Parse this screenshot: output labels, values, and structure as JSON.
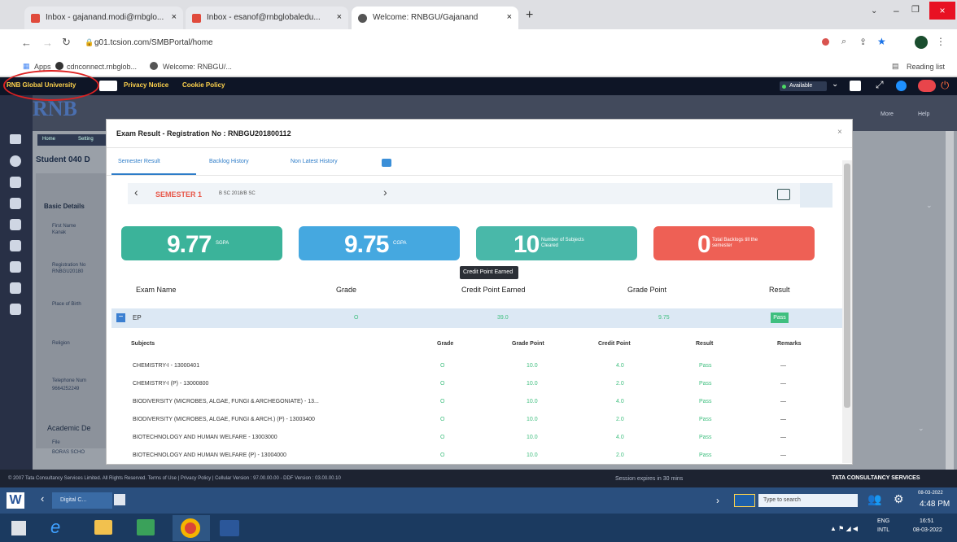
{
  "browser": {
    "tabs": [
      {
        "title": "Inbox - gajanand.modi@rnbglo..."
      },
      {
        "title": "Inbox - esanof@rnbglobaledu..."
      },
      {
        "title": "Welcome: RNBGU/Gajanand"
      }
    ],
    "url": "g01.tcsion.com/SMBPortal/home",
    "bookmarks": {
      "apps": "Apps",
      "b1": "cdnconnect.rnbglob...",
      "b2": "Welcome: RNBGU/..."
    },
    "reading_list": "Reading list"
  },
  "appbar": {
    "org": "RNB Global University",
    "privacy": "Privacy Notice",
    "cookie": "Cookie Policy",
    "status": "Available"
  },
  "bg": {
    "logo": "RNB",
    "breadcrumb1": "Home",
    "breadcrumb2": "Setting",
    "student": "Student 040 D",
    "basic_details": "Basic Details",
    "first_name": "First Name",
    "first_name_val": "Kanak",
    "registration": "Registration No",
    "registration_val": "RNBGU20180",
    "dob": "Place of Birth",
    "religion": "Religion",
    "telephone": "Telephone Num",
    "telephone_val": "9664252249",
    "academic": "Academic De",
    "file": "File",
    "file_val": "BORAS SCHO",
    "more": "More",
    "help": "Help"
  },
  "modal": {
    "title": "Exam Result - Registration No : RNBGU201800112",
    "tabs": [
      "Semester Result",
      "Backlog History",
      "Non Latest History"
    ],
    "semester": "SEMESTER 1",
    "semester_sub": "B SC 2018/B SC",
    "stats": [
      {
        "value": "9.77",
        "label": "SGPA",
        "color": "#3bb39a"
      },
      {
        "value": "9.75",
        "label": "CGPA",
        "color": "#45a8e0"
      },
      {
        "value": "10",
        "label": "Number of Subjects Cleared",
        "color": "#49b8a9"
      },
      {
        "value": "0",
        "label": "Total Backlogs till the semester",
        "color": "#ee6055"
      }
    ],
    "tooltip": "Credit Point Earned",
    "columns": [
      "Exam Name",
      "Grade",
      "Credit Point Earned",
      "Grade Point",
      "Result"
    ],
    "exam": {
      "name": "EP",
      "grade": "O",
      "credit_earned": "39.0",
      "grade_point": "9.75",
      "result": "Pass"
    },
    "subject_columns": [
      "Subjects",
      "Grade",
      "Grade Point",
      "Credit Point",
      "Result",
      "Remarks"
    ],
    "subjects": [
      {
        "name": "CHEMISTRY-I - 13000401",
        "grade": "O",
        "gp": "10.0",
        "cp": "4.0",
        "result": "Pass",
        "remarks": "—"
      },
      {
        "name": "CHEMISTRY-I (P) - 13000800",
        "grade": "O",
        "gp": "10.0",
        "cp": "2.0",
        "result": "Pass",
        "remarks": "—"
      },
      {
        "name": "BIODIVERSITY (MICROBES, ALGAE, FUNGI & ARCHEGONIATE) - 13...",
        "grade": "O",
        "gp": "10.0",
        "cp": "4.0",
        "result": "Pass",
        "remarks": "—"
      },
      {
        "name": "BIODIVERSITY (MICROBES, ALGAE, FUNGI & ARCH.) (P) - 13003400",
        "grade": "O",
        "gp": "10.0",
        "cp": "2.0",
        "result": "Pass",
        "remarks": "—"
      },
      {
        "name": "BIOTECHNOLOGY AND HUMAN WELFARE - 13003000",
        "grade": "O",
        "gp": "10.0",
        "cp": "4.0",
        "result": "Pass",
        "remarks": "—"
      },
      {
        "name": "BIOTECHNOLOGY AND HUMAN WELFARE (P) - 13004000",
        "grade": "O",
        "gp": "10.0",
        "cp": "2.0",
        "result": "Pass",
        "remarks": "—"
      }
    ]
  },
  "footer": {
    "copyright": "© 2007 Tata Consultancy Services Limited. All Rights Reserved.  Terms of Use | Privacy Policy | Cellular Version : 97.00.00.00 - DDF Version : 03.00.00.10",
    "session": "Session expires in 30 mins",
    "tcs": "TATA CONSULTANCY SERVICES"
  },
  "taskbar": {
    "window": "Digital C...",
    "search": "Type to search",
    "time": "4:48 PM",
    "date": "08-03-2022",
    "lang": "ENG",
    "lang2": "INTL",
    "time2": "16:51",
    "date2": "08-03-2022"
  }
}
